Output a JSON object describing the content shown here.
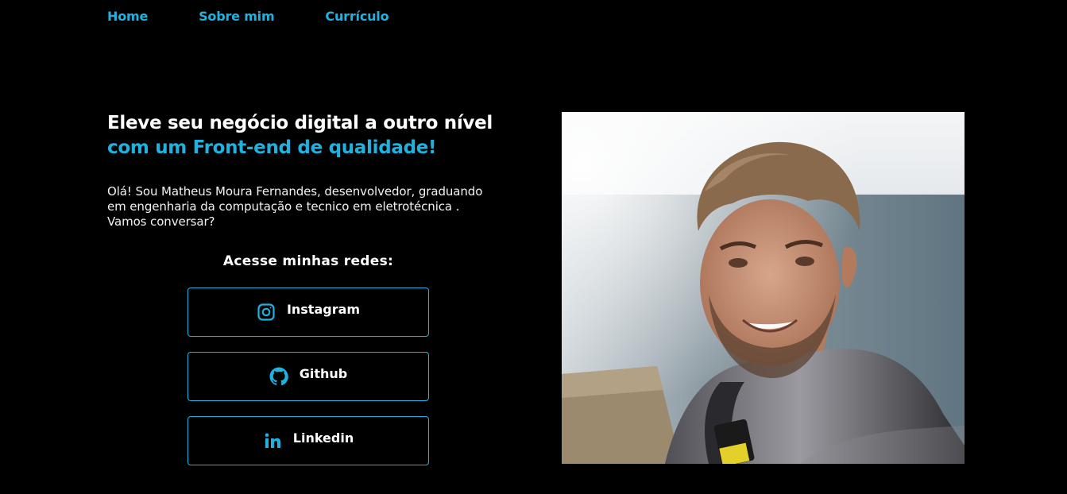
{
  "nav": {
    "items": [
      {
        "label": "Home"
      },
      {
        "label": "Sobre mim"
      },
      {
        "label": "Currículo"
      }
    ]
  },
  "hero": {
    "title_line1": "Eleve seu negócio digital a outro nível",
    "title_line2": "com um Front-end de qualidade!",
    "intro_line1": "Olá! Sou Matheus Moura Fernandes, desenvolvedor, graduando",
    "intro_line2": "em engenharia da computação e tecnico em eletrotécnica .",
    "intro_line3": "Vamos conversar?"
  },
  "social": {
    "title": "Acesse minhas redes:",
    "buttons": [
      {
        "label": "Instagram",
        "icon": "instagram-icon"
      },
      {
        "label": "Github",
        "icon": "github-icon"
      },
      {
        "label": "Linkedin",
        "icon": "linkedin-icon"
      }
    ]
  },
  "colors": {
    "accent": "#1fb2e0",
    "background": "#000000",
    "text": "#ffffff"
  }
}
